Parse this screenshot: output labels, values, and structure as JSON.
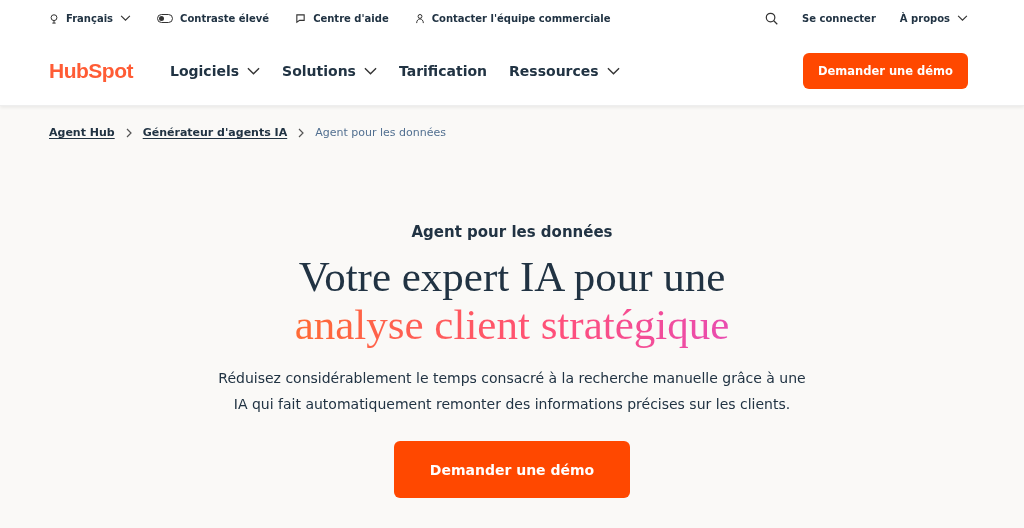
{
  "utility_bar": {
    "language": "Français",
    "contrast": {
      "label": "Contraste élevé",
      "on": false
    },
    "help": "Centre d'aide",
    "sales": "Contacter l'équipe commerciale",
    "login": "Se connecter",
    "about": "À propos"
  },
  "nav": {
    "logo": "HubSpot",
    "items": [
      {
        "label": "Logiciels",
        "dropdown": true
      },
      {
        "label": "Solutions",
        "dropdown": true
      },
      {
        "label": "Tarification",
        "dropdown": false
      },
      {
        "label": "Ressources",
        "dropdown": true
      }
    ],
    "cta": "Demander une démo"
  },
  "breadcrumb": [
    {
      "label": "Agent Hub",
      "current": false
    },
    {
      "label": "Générateur d'agents IA",
      "current": false
    },
    {
      "label": "Agent pour les données",
      "current": true
    }
  ],
  "hero": {
    "eyebrow": "Agent pour les données",
    "title_line": "Votre expert IA pour une",
    "title_highlight": "analyse client stratégique",
    "description": "Réduisez considérablement le temps consacré à la recherche manuelle grâce à une IA qui fait automatiquement remonter des informations précises sur les clients.",
    "cta": "Demander une démo"
  }
}
